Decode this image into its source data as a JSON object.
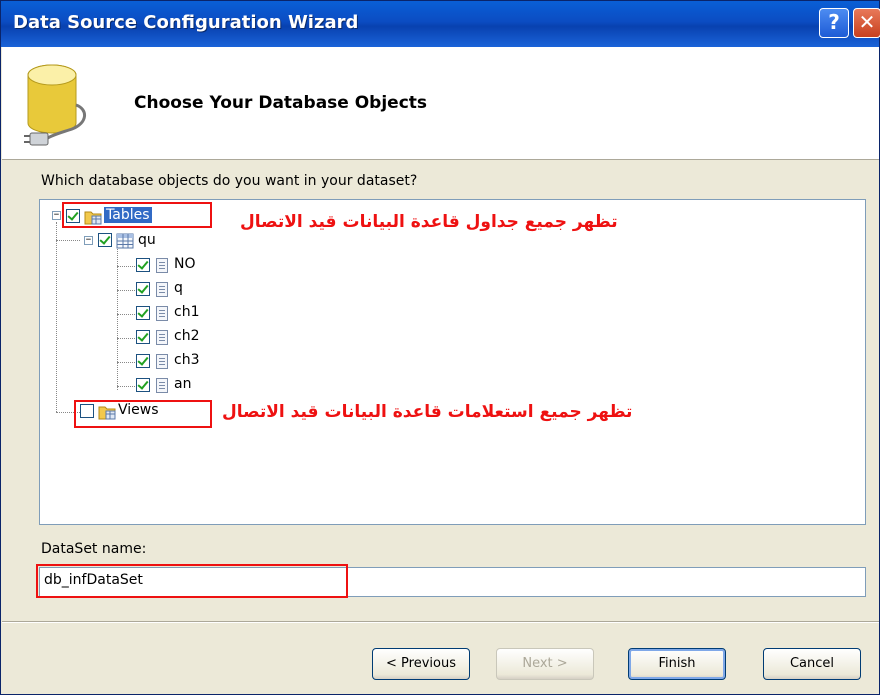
{
  "window": {
    "title": "Data Source Configuration Wizard",
    "help_glyph": "?",
    "close_glyph": "✕"
  },
  "header": {
    "title": "Choose Your Database Objects",
    "icon": "database-plug-icon"
  },
  "prompt": "Which database objects do you want in your dataset?",
  "tree": {
    "tables": {
      "label": "Tables",
      "checked": true,
      "expanded": true
    },
    "table": {
      "label": "qu",
      "checked": true,
      "expanded": true
    },
    "columns": [
      "NO",
      "q",
      "ch1",
      "ch2",
      "ch3",
      "an"
    ],
    "views": {
      "label": "Views",
      "checked": false
    }
  },
  "annotations": {
    "tables_note": "تظهر جميع جداول قاعدة البيانات قيد الاتصال",
    "views_note": "تظهر جميع استعلامات قاعدة البيانات قيد الاتصال",
    "color": "#e11111"
  },
  "dataset": {
    "label": "DataSet name:",
    "value": "db_infDataSet"
  },
  "buttons": {
    "previous": "< Previous",
    "next": "Next >",
    "finish": "Finish",
    "cancel": "Cancel"
  }
}
